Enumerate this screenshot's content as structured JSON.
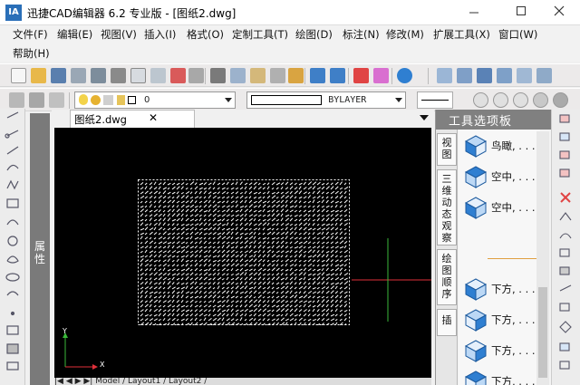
{
  "window": {
    "title": "迅捷CAD编辑器 6.2 专业版  -  [图纸2.dwg]",
    "app_icon_text": "IA",
    "minimize_icon": "minimize-icon",
    "maximize_icon": "maximize-icon",
    "close_icon": "close-icon"
  },
  "menu": {
    "row1": [
      "文件(F)",
      "编辑(E)",
      "视图(V)",
      "插入(I)",
      "格式(O)",
      "定制工具(T)",
      "绘图(D)",
      "标注(N)",
      "修改(M)",
      "扩展工具(X)",
      "窗口(W)"
    ],
    "row2": [
      "帮助(H)"
    ]
  },
  "layer_bar": {
    "layer_value": "0",
    "linetype_value": "BYLAYER"
  },
  "doc_tab": {
    "label": "图纸2.dwg",
    "close": "✕"
  },
  "properties_panel": {
    "label": "属性"
  },
  "tool_palette": {
    "title": "工具选项板",
    "tabs": [
      "视图",
      "三维动态观察",
      "绘图顺序",
      "插"
    ],
    "items": [
      {
        "label": "鸟瞰, . . .",
        "icon": "cube-icon"
      },
      {
        "label": "空中, . . .",
        "icon": "cube-icon"
      },
      {
        "label": "空中, . . .",
        "icon": "cube-icon"
      },
      {
        "label": "下方, . . .",
        "icon": "cube-icon"
      },
      {
        "label": "下方, . . .",
        "icon": "cube-icon"
      },
      {
        "label": "下方, . . .",
        "icon": "cube-icon"
      },
      {
        "label": "下方, . . .",
        "icon": "cube-icon"
      }
    ]
  },
  "model_tabs": {
    "text": "|◀ ◀ ▶ ▶| Model / Layout1 / Layout2 /"
  },
  "ucs": {
    "x_label": "X",
    "y_label": "Y"
  },
  "colors": {
    "canvas_bg": "#000000",
    "crosshair_h": "#e0303a",
    "crosshair_v": "#3ab83a",
    "hatch": "#ffffff",
    "palette_header": "#808080",
    "cube_blue": "#2f7fd1"
  }
}
